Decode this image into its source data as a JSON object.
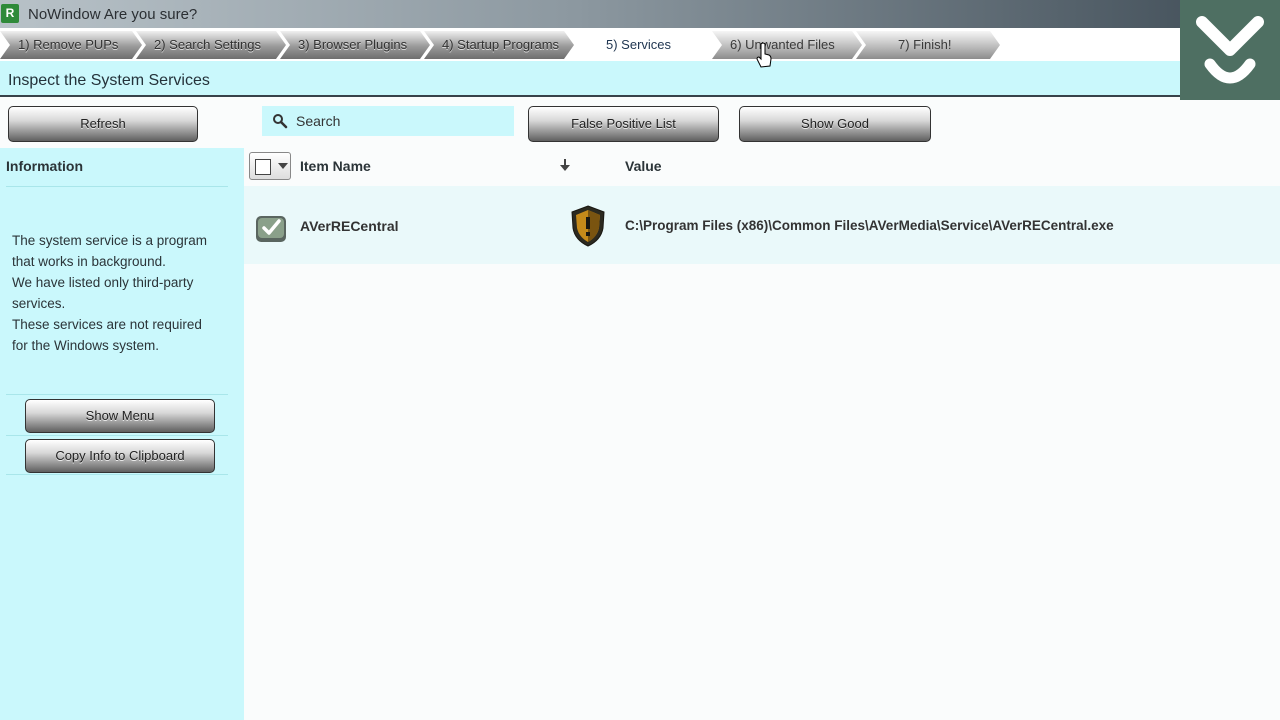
{
  "window": {
    "title": "NoWindow Are you sure?",
    "app_icon_letter": "R"
  },
  "steps": [
    {
      "label": "1) Remove PUPs",
      "state": "done"
    },
    {
      "label": "2) Search Settings",
      "state": "done"
    },
    {
      "label": "3) Browser Plugins",
      "state": "done"
    },
    {
      "label": "4) Startup Programs",
      "state": "done"
    },
    {
      "label": "5) Services",
      "state": "current"
    },
    {
      "label": "6) Unwanted Files",
      "state": "todo"
    },
    {
      "label": "7) Finish!",
      "state": "todo"
    }
  ],
  "header": {
    "title": "Inspect the System Services"
  },
  "toolbar": {
    "refresh_label": "Refresh",
    "search_placeholder": "Search",
    "false_positive_label": "False Positive List",
    "show_good_label": "Show Good"
  },
  "sidebar": {
    "heading": "Information",
    "lines": [
      "The system service is a program",
      "that works in background.",
      "We have listed only third-party",
      "services.",
      "These services are not required",
      "for the Windows system."
    ],
    "show_menu_label": "Show Menu",
    "copy_info_label": "Copy Info to Clipboard"
  },
  "list": {
    "columns": {
      "name": "Item Name",
      "value": "Value"
    },
    "rows": [
      {
        "name": "AVerRECentral",
        "value": "C:\\Program Files (x86)\\Common Files\\AVerMedia\\Service\\AVerRECentral.exe"
      }
    ]
  },
  "colors": {
    "accent": "#caf8fc",
    "logo_bg": "#4e6f62"
  }
}
